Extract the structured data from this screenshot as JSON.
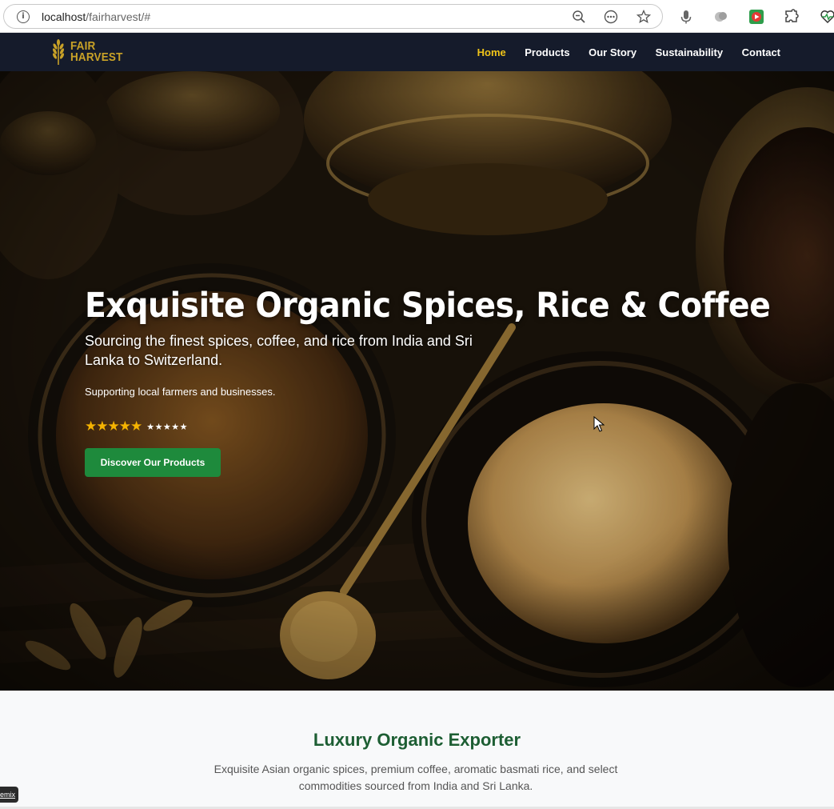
{
  "browser": {
    "url_host": "localhost",
    "url_path": "/fairharvest/#"
  },
  "nav": {
    "logo_line1": "FAIR",
    "logo_line2": "HARVEST",
    "links": [
      {
        "label": "Home",
        "active": true
      },
      {
        "label": "Products",
        "active": false
      },
      {
        "label": "Our Story",
        "active": false
      },
      {
        "label": "Sustainability",
        "active": false
      },
      {
        "label": "Contact",
        "active": false
      }
    ]
  },
  "hero": {
    "title": "Exquisite Organic Spices, Rice & Coffee",
    "subtitle": "Sourcing the finest spices, coffee, and rice from India and Sri Lanka to Switzerland.",
    "tagline": "Supporting local farmers and businesses.",
    "stars_gold": "★★★★★",
    "stars_white": "★★★★★",
    "cta_label": "Discover Our Products"
  },
  "section": {
    "title": "Luxury Organic Exporter",
    "description": "Exquisite Asian organic spices, premium coffee, aromatic basmati rice, and select commodities sourced from India and Sri Lanka."
  },
  "badge": {
    "label": "emix"
  },
  "colors": {
    "nav_bg": "#151b2b",
    "nav_active": "#f0c419",
    "logo_gold": "#c9a227",
    "cta_green": "#1e8a3c",
    "section_title": "#1d5e33"
  }
}
